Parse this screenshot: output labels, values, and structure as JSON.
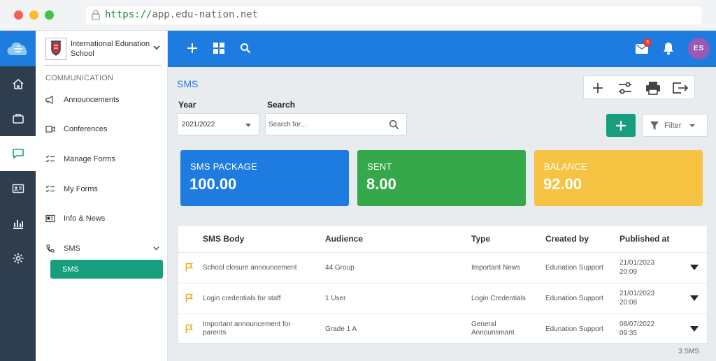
{
  "browser": {
    "url_protocol": "https://",
    "url_rest": "app.edu-nation.net"
  },
  "rail": {
    "items": [
      "home-icon",
      "briefcase-icon",
      "chat-icon",
      "id-card-icon",
      "chart-icon",
      "gear-icon"
    ],
    "active": "chat-icon"
  },
  "sidebar": {
    "school_name": "International Edunation School",
    "section": "COMMUNICATION",
    "items": [
      {
        "label": "Announcements",
        "icon": "megaphone-icon"
      },
      {
        "label": "Conferences",
        "icon": "video-icon"
      },
      {
        "label": "Manage Forms",
        "icon": "checklist-icon"
      },
      {
        "label": "My Forms",
        "icon": "checklist-icon"
      },
      {
        "label": "Info & News",
        "icon": "news-icon"
      },
      {
        "label": "SMS",
        "icon": "phone-icon"
      }
    ],
    "sub_active": "SMS"
  },
  "topbar": {
    "mail_badge": "3",
    "avatar_initials": "ES"
  },
  "page": {
    "title": "SMS",
    "year_label": "Year",
    "year_value": "2021/2022",
    "search_label": "Search",
    "search_placeholder": "Search for...",
    "filter_label": "Filter"
  },
  "cards": [
    {
      "title": "SMS PACKAGE",
      "value": "100.00",
      "color": "#1e7be0"
    },
    {
      "title": "SENT",
      "value": "8.00",
      "color": "#34a84a"
    },
    {
      "title": "BALANCE",
      "value": "92.00",
      "color": "#f6c343"
    }
  ],
  "table": {
    "headers": [
      "SMS Body",
      "Audience",
      "Type",
      "Created by",
      "Published at"
    ],
    "rows": [
      {
        "body": "School closure announcement",
        "audience": "44 Group",
        "type": "Important News",
        "created_by": "Edunation Support",
        "date": "21/01/2023",
        "time": "20:09"
      },
      {
        "body": "Login credentials for staff",
        "audience": "1 User",
        "type": "Login Credentials",
        "created_by": "Edunation Support",
        "date": "21/01/2023",
        "time": "20:08"
      },
      {
        "body": "Important announcement for parents",
        "audience": "Grade 1 A",
        "type": "General Announsmant",
        "created_by": "Edunation Support",
        "date": "08/07/2022",
        "time": "09:35"
      }
    ],
    "count": "3 SMS"
  }
}
